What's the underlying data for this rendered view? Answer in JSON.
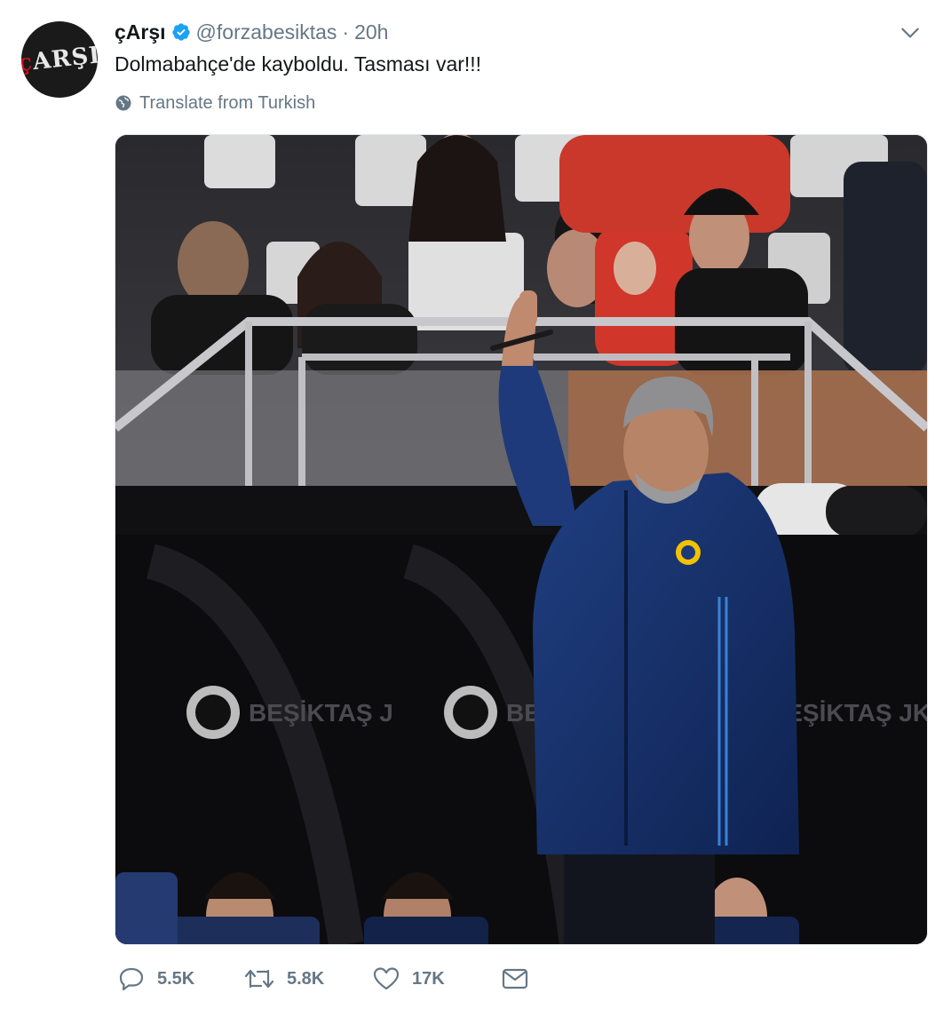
{
  "author": {
    "display_name": "çArşı",
    "handle": "@forzabesiktas",
    "separator": "·",
    "timestamp": "20h",
    "avatar_text_a": "ç",
    "avatar_text_b": "ARŞI"
  },
  "tweet": {
    "text": "Dolmabahçe'de kayboldu. Tasması var!!!",
    "translate_label": "Translate from Turkish"
  },
  "media": {
    "banner_text_left": "BEŞİKTAŞ J",
    "banner_text_mid": "BEŞ",
    "banner_text_right": "BEŞİKTAŞ JK"
  },
  "actions": {
    "replies": "5.5K",
    "retweets": "5.8K",
    "likes": "17K"
  },
  "colors": {
    "verified": "#1da1f2",
    "muted": "#657786",
    "text": "#14171a"
  }
}
